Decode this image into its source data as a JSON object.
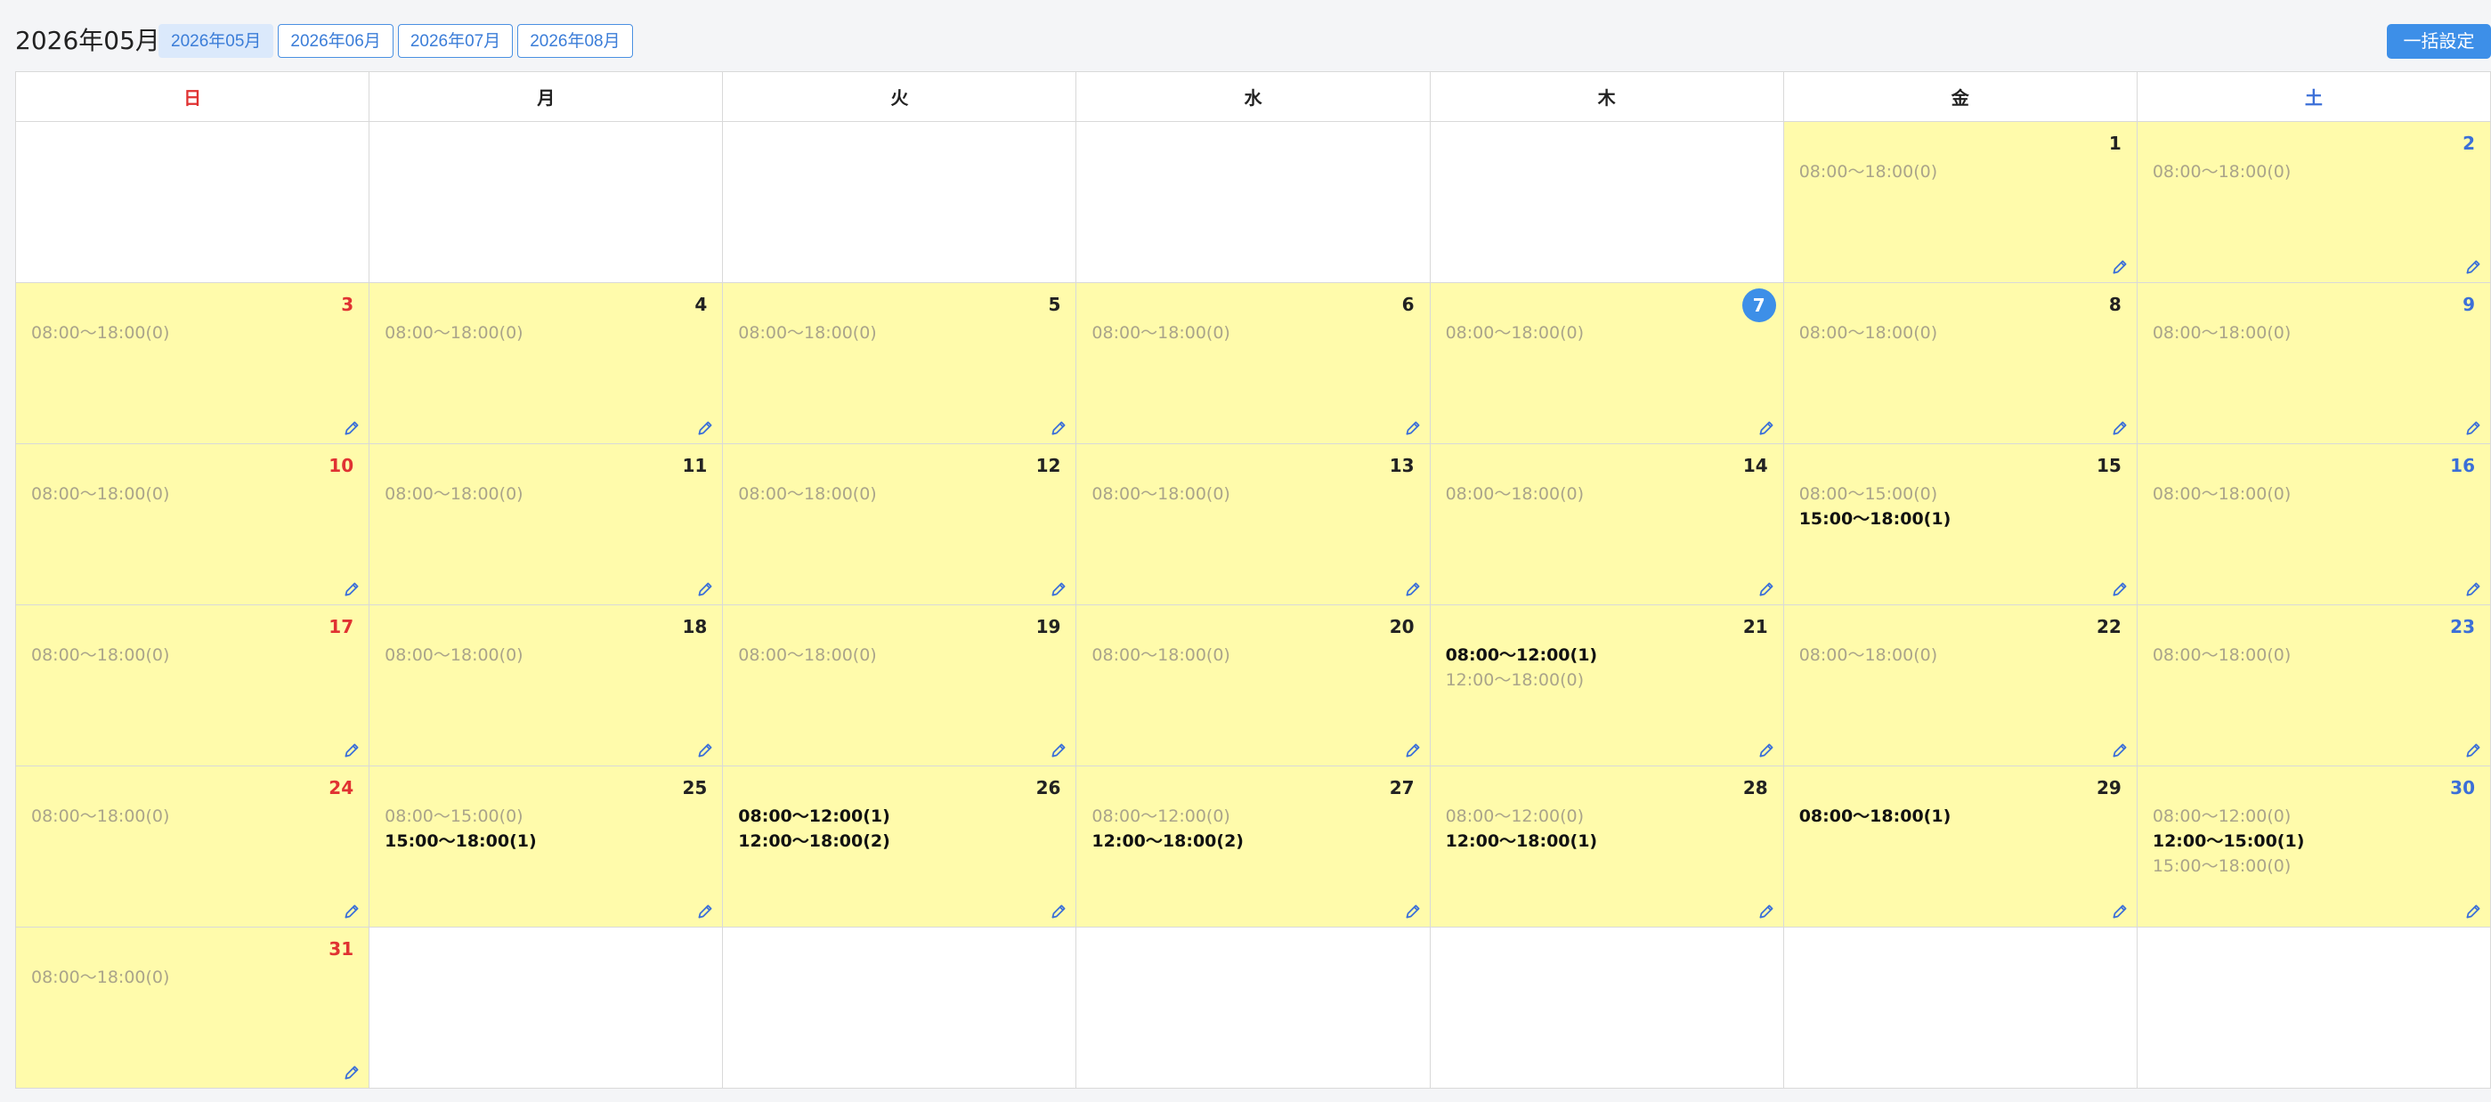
{
  "header": {
    "title": "2026年05月",
    "month_tabs": [
      "2026年05月",
      "2026年06月",
      "2026年07月",
      "2026年08月"
    ],
    "active_month_index": 0,
    "bulk_button": "一括設定"
  },
  "weekdays": [
    "日",
    "月",
    "火",
    "水",
    "木",
    "金",
    "土"
  ],
  "today": 7,
  "colors": {
    "accent": "#3d8fe8",
    "sunday": "#e03232",
    "saturday": "#3b6fd8",
    "active_day_bg": "#fffbab"
  },
  "icons": {
    "edit": "pencil-icon"
  },
  "days": [
    {
      "day": 1,
      "slots": [
        {
          "text": "08:00〜18:00(0)",
          "booked": false
        }
      ]
    },
    {
      "day": 2,
      "slots": [
        {
          "text": "08:00〜18:00(0)",
          "booked": false
        }
      ]
    },
    {
      "day": 3,
      "slots": [
        {
          "text": "08:00〜18:00(0)",
          "booked": false
        }
      ]
    },
    {
      "day": 4,
      "slots": [
        {
          "text": "08:00〜18:00(0)",
          "booked": false
        }
      ]
    },
    {
      "day": 5,
      "slots": [
        {
          "text": "08:00〜18:00(0)",
          "booked": false
        }
      ]
    },
    {
      "day": 6,
      "slots": [
        {
          "text": "08:00〜18:00(0)",
          "booked": false
        }
      ]
    },
    {
      "day": 7,
      "slots": [
        {
          "text": "08:00〜18:00(0)",
          "booked": false
        }
      ]
    },
    {
      "day": 8,
      "slots": [
        {
          "text": "08:00〜18:00(0)",
          "booked": false
        }
      ]
    },
    {
      "day": 9,
      "slots": [
        {
          "text": "08:00〜18:00(0)",
          "booked": false
        }
      ]
    },
    {
      "day": 10,
      "slots": [
        {
          "text": "08:00〜18:00(0)",
          "booked": false
        }
      ]
    },
    {
      "day": 11,
      "slots": [
        {
          "text": "08:00〜18:00(0)",
          "booked": false
        }
      ]
    },
    {
      "day": 12,
      "slots": [
        {
          "text": "08:00〜18:00(0)",
          "booked": false
        }
      ]
    },
    {
      "day": 13,
      "slots": [
        {
          "text": "08:00〜18:00(0)",
          "booked": false
        }
      ]
    },
    {
      "day": 14,
      "slots": [
        {
          "text": "08:00〜18:00(0)",
          "booked": false
        }
      ]
    },
    {
      "day": 15,
      "slots": [
        {
          "text": "08:00〜15:00(0)",
          "booked": false
        },
        {
          "text": "15:00〜18:00(1)",
          "booked": true
        }
      ]
    },
    {
      "day": 16,
      "slots": [
        {
          "text": "08:00〜18:00(0)",
          "booked": false
        }
      ]
    },
    {
      "day": 17,
      "slots": [
        {
          "text": "08:00〜18:00(0)",
          "booked": false
        }
      ]
    },
    {
      "day": 18,
      "slots": [
        {
          "text": "08:00〜18:00(0)",
          "booked": false
        }
      ]
    },
    {
      "day": 19,
      "slots": [
        {
          "text": "08:00〜18:00(0)",
          "booked": false
        }
      ]
    },
    {
      "day": 20,
      "slots": [
        {
          "text": "08:00〜18:00(0)",
          "booked": false
        }
      ]
    },
    {
      "day": 21,
      "slots": [
        {
          "text": "08:00〜12:00(1)",
          "booked": true
        },
        {
          "text": "12:00〜18:00(0)",
          "booked": false
        }
      ]
    },
    {
      "day": 22,
      "slots": [
        {
          "text": "08:00〜18:00(0)",
          "booked": false
        }
      ]
    },
    {
      "day": 23,
      "slots": [
        {
          "text": "08:00〜18:00(0)",
          "booked": false
        }
      ]
    },
    {
      "day": 24,
      "slots": [
        {
          "text": "08:00〜18:00(0)",
          "booked": false
        }
      ]
    },
    {
      "day": 25,
      "slots": [
        {
          "text": "08:00〜15:00(0)",
          "booked": false
        },
        {
          "text": "15:00〜18:00(1)",
          "booked": true
        }
      ]
    },
    {
      "day": 26,
      "slots": [
        {
          "text": "08:00〜12:00(1)",
          "booked": true
        },
        {
          "text": "12:00〜18:00(2)",
          "booked": true
        }
      ]
    },
    {
      "day": 27,
      "slots": [
        {
          "text": "08:00〜12:00(0)",
          "booked": false
        },
        {
          "text": "12:00〜18:00(2)",
          "booked": true
        }
      ]
    },
    {
      "day": 28,
      "slots": [
        {
          "text": "08:00〜12:00(0)",
          "booked": false
        },
        {
          "text": "12:00〜18:00(1)",
          "booked": true
        }
      ]
    },
    {
      "day": 29,
      "slots": [
        {
          "text": "08:00〜18:00(1)",
          "booked": true
        }
      ]
    },
    {
      "day": 30,
      "slots": [
        {
          "text": "08:00〜12:00(0)",
          "booked": false
        },
        {
          "text": "12:00〜15:00(1)",
          "booked": true
        },
        {
          "text": "15:00〜18:00(0)",
          "booked": false
        }
      ]
    },
    {
      "day": 31,
      "slots": [
        {
          "text": "08:00〜18:00(0)",
          "booked": false
        }
      ]
    }
  ]
}
